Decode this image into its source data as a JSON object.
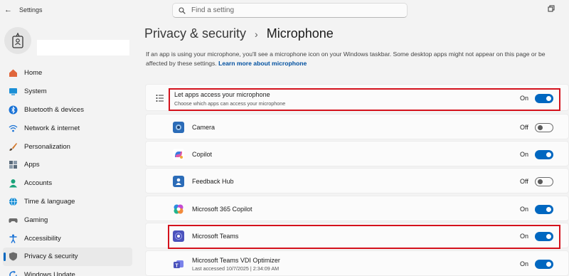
{
  "window": {
    "title": "Settings"
  },
  "search": {
    "placeholder": "Find a setting"
  },
  "sidebar": {
    "items": [
      {
        "label": "Home",
        "icon": "home-icon",
        "color": "#e0663c"
      },
      {
        "label": "System",
        "icon": "system-icon",
        "color": "#1a8fd6"
      },
      {
        "label": "Bluetooth & devices",
        "icon": "bluetooth-icon",
        "color": "#1a73d6"
      },
      {
        "label": "Network & internet",
        "icon": "wifi-icon",
        "color": "#1a73d6"
      },
      {
        "label": "Personalization",
        "icon": "brush-icon",
        "color": "#d2762a"
      },
      {
        "label": "Apps",
        "icon": "apps-icon",
        "color": "#5a6a7a"
      },
      {
        "label": "Accounts",
        "icon": "accounts-icon",
        "color": "#1aa37a"
      },
      {
        "label": "Time & language",
        "icon": "globe-icon",
        "color": "#1a8fd6"
      },
      {
        "label": "Gaming",
        "icon": "gaming-icon",
        "color": "#6b6b6b"
      },
      {
        "label": "Accessibility",
        "icon": "accessibility-icon",
        "color": "#1a73d6"
      },
      {
        "label": "Privacy & security",
        "icon": "shield-icon",
        "color": "#6b6b6b"
      },
      {
        "label": "Windows Update",
        "icon": "update-icon",
        "color": "#1a73d6"
      }
    ],
    "active_index": 10
  },
  "main": {
    "breadcrumb_parent": "Privacy & security",
    "breadcrumb_sep": "›",
    "breadcrumb_current": "Microphone",
    "description": "If an app is using your microphone, you'll see a microphone icon on your Windows taskbar. Some desktop apps might not appear on this page or be affected by these settings.",
    "learn_more": "Learn more about microphone",
    "master": {
      "label": "Let apps access your microphone",
      "sublabel": "Choose which apps can access your microphone",
      "state": "On",
      "on": true
    },
    "apps": [
      {
        "name": "Camera",
        "sublabel": "",
        "state": "Off",
        "on": false,
        "icon": "camera-app-icon"
      },
      {
        "name": "Copilot",
        "sublabel": "",
        "state": "On",
        "on": true,
        "icon": "copilot-app-icon"
      },
      {
        "name": "Feedback Hub",
        "sublabel": "",
        "state": "Off",
        "on": false,
        "icon": "feedback-hub-app-icon"
      },
      {
        "name": "Microsoft 365 Copilot",
        "sublabel": "",
        "state": "On",
        "on": true,
        "icon": "m365-copilot-app-icon"
      },
      {
        "name": "Microsoft Teams",
        "sublabel": "",
        "state": "On",
        "on": true,
        "icon": "teams-app-icon"
      },
      {
        "name": "Microsoft Teams VDI Optimizer",
        "sublabel": "Last accessed 10/7/2025 | 2:34:09 AM",
        "state": "On",
        "on": true,
        "icon": "teams-vdi-app-icon"
      }
    ]
  },
  "colors": {
    "accent": "#0067c0",
    "highlight": "#d4121c"
  }
}
